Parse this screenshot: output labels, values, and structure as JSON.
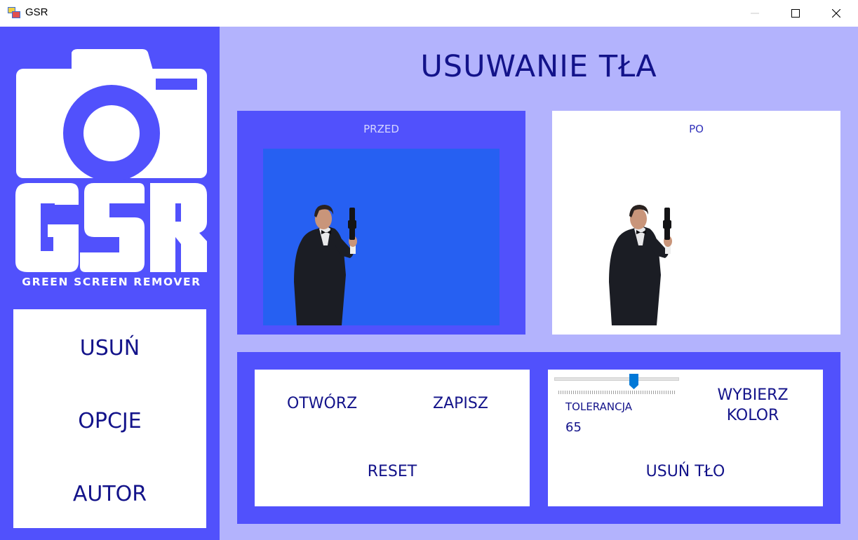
{
  "window": {
    "title": "GSR",
    "minimize_icon": "minimize-icon",
    "maximize_icon": "maximize-icon",
    "close_icon": "close-icon"
  },
  "sidebar": {
    "logo": {
      "letters": "GSR",
      "tagline": "GREEN SCREEN REMOVER",
      "icon": "camera-icon"
    },
    "menu": [
      {
        "label": "USUŃ"
      },
      {
        "label": "OPCJE"
      },
      {
        "label": "AUTOR"
      }
    ]
  },
  "main": {
    "title": "USUWANIE TŁA",
    "before": {
      "label": "PRZED"
    },
    "after": {
      "label": "PO"
    },
    "file_controls": {
      "open_label": "OTWÓRZ",
      "save_label": "ZAPISZ",
      "reset_label": "RESET"
    },
    "removal_controls": {
      "tolerance_label": "TOLERANCJA",
      "tolerance_value": "65",
      "choose_color_line1": "WYBIERZ",
      "choose_color_line2": "KOLOR",
      "remove_bg_label": "USUŃ TŁO"
    }
  },
  "colors": {
    "accent": "#5151fc",
    "background": "#b3b3fd",
    "text": "#13138a",
    "screen_blue": "#2660f2"
  }
}
